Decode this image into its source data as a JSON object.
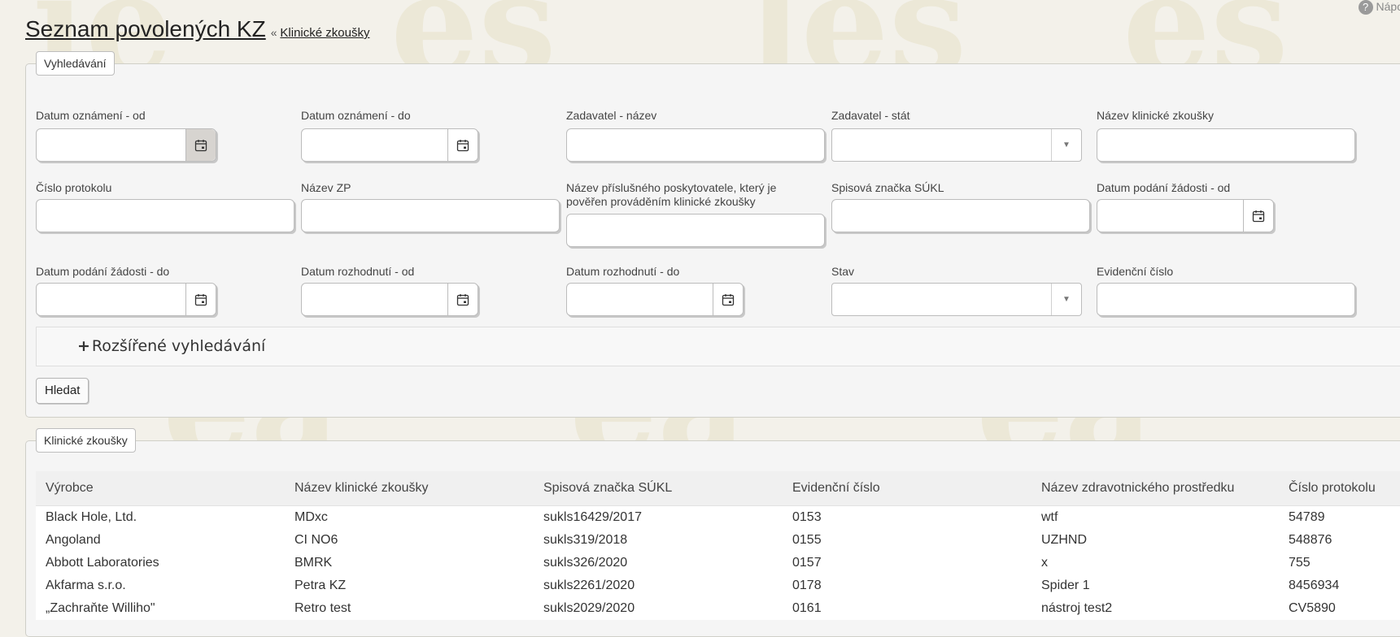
{
  "help_label": "Nápo",
  "title": {
    "main": "Seznam povolených KZ",
    "separator": "«",
    "crumb": "Klinické zkoušky"
  },
  "search": {
    "legend": "Vyhledávání",
    "fields": {
      "datum_oznameni_od": "Datum oznámení - od",
      "datum_oznameni_do": "Datum oznámení - do",
      "zadavatel_nazev": "Zadavatel - název",
      "zadavatel_stat": "Zadavatel - stát",
      "nazev_kz": "Název klinické zkoušky",
      "cislo_protokolu": "Číslo protokolu",
      "nazev_zp": "Název ZP",
      "poskytovatel": "Název příslušného poskytovatele, který je pověřen prováděním klinické zkoušky",
      "spisova_znacka": "Spisová značka SÚKL",
      "datum_podani_od": "Datum podání žádosti - od",
      "datum_podani_do": "Datum podání žádosti - do",
      "datum_rozhodnuti_od": "Datum rozhodnutí - od",
      "datum_rozhodnuti_do": "Datum rozhodnutí - do",
      "stav": "Stav",
      "evidencni_cislo": "Evidenční číslo"
    },
    "advanced_label": "Rozšířené vyhledávání",
    "search_button": "Hledat"
  },
  "results": {
    "legend": "Klinické zkoušky",
    "columns": [
      "Výrobce",
      "Název klinické zkoušky",
      "Spisová značka SÚKL",
      "Evidenční číslo",
      "Název zdravotnického prostředku",
      "Číslo protokolu"
    ],
    "rows": [
      [
        "Black Hole, Ltd.",
        "MDxc",
        "sukls16429/2017",
        "0153",
        "wtf",
        "54789"
      ],
      [
        "Angoland",
        "CI NO6",
        "sukls319/2018",
        "0155",
        "UZHND",
        "548876"
      ],
      [
        "Abbott Laboratories",
        "BMRK",
        "sukls326/2020",
        "0157",
        "x",
        "755"
      ],
      [
        "Akfarma s.r.o.",
        "Petra KZ",
        "sukls2261/2020",
        "0178",
        "Spider 1",
        "8456934"
      ],
      [
        "„Zachraňte Williho\"",
        "Retro test",
        "sukls2029/2020",
        "0161",
        "nástroj test2",
        "CV5890"
      ]
    ]
  }
}
